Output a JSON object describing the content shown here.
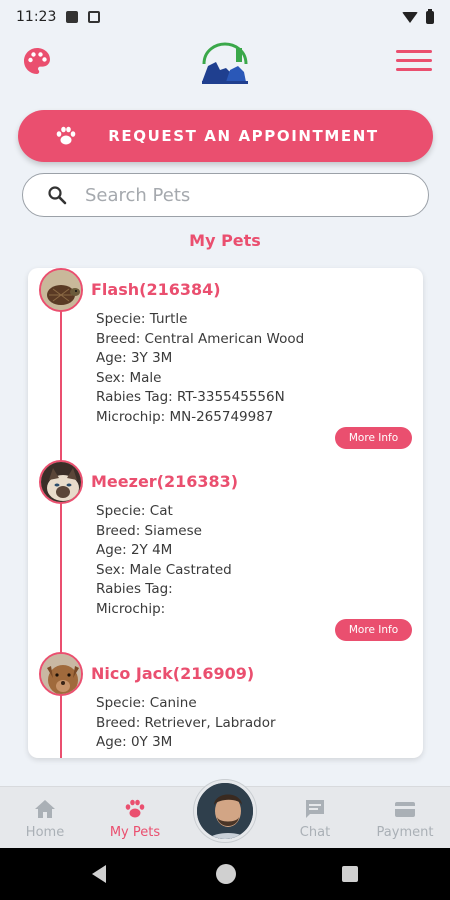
{
  "status_bar": {
    "time": "11:23"
  },
  "header": {
    "logo_icon": "veterinary-clinic-logo",
    "palette_icon": "palette-icon",
    "menu_icon": "hamburger-menu-icon"
  },
  "request_button": {
    "label": "REQUEST AN APPOINTMENT",
    "icon": "paw-icon"
  },
  "search": {
    "placeholder": "Search Pets",
    "value": ""
  },
  "section_title": "My Pets",
  "pets": [
    {
      "name": "Flash(216384)",
      "details": [
        "Specie: Turtle",
        "Breed: Central American Wood",
        "Age: 3Y 3M",
        "Sex: Male",
        "Rabies Tag: RT-335545556N",
        "Microchip: MN-265749987"
      ],
      "button": "More Info"
    },
    {
      "name": "Meezer(216383)",
      "details": [
        "Specie: Cat",
        "Breed: Siamese",
        "Age: 2Y 4M",
        "Sex: Male Castrated",
        "Rabies Tag:",
        "Microchip:"
      ],
      "button": "More Info"
    },
    {
      "name": "Nico Jack(216909)",
      "details": [
        "Specie: Canine",
        "Breed: Retriever, Labrador",
        "Age: 0Y 3M"
      ],
      "button": ""
    }
  ],
  "bottom_nav": [
    {
      "label": "Home",
      "icon": "home-icon",
      "active": false
    },
    {
      "label": "My Pets",
      "icon": "paw-icon",
      "active": true
    },
    {
      "label": "Chat",
      "icon": "chat-icon",
      "active": false
    },
    {
      "label": "Payment",
      "icon": "credit-card-icon",
      "active": false
    }
  ],
  "colors": {
    "accent": "#ea4f6f",
    "background": "#eef2f7",
    "nav_inactive": "#aab0b6"
  }
}
